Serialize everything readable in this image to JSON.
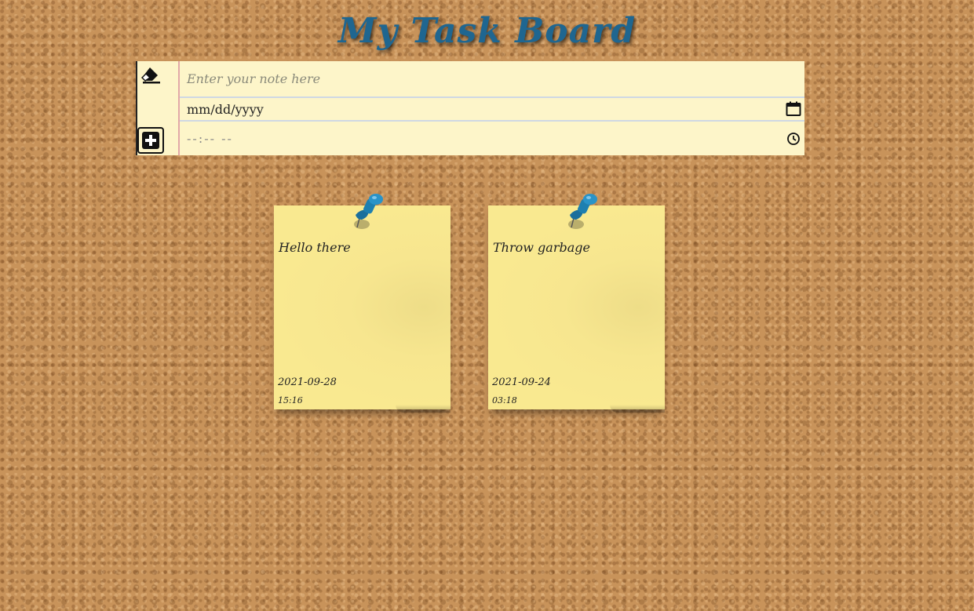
{
  "app": {
    "title": "My Task Board"
  },
  "form": {
    "note_placeholder": "Enter your note here",
    "date_value": "mm/dd/yyyy",
    "time_value": "--:-- --",
    "icons": {
      "clear": "eraser-icon",
      "add": "plus-square-icon",
      "calendar": "calendar-icon",
      "clock": "clock-icon"
    }
  },
  "notes": [
    {
      "text": "Hello there",
      "date": "2021-09-28",
      "time": "15:16"
    },
    {
      "text": "Throw garbage",
      "date": "2021-09-24",
      "time": "03:18"
    }
  ],
  "colors": {
    "title": "#1f6690",
    "note": "#f9e990",
    "form": "#fdf5c9",
    "pin": "#1e7fb0"
  }
}
